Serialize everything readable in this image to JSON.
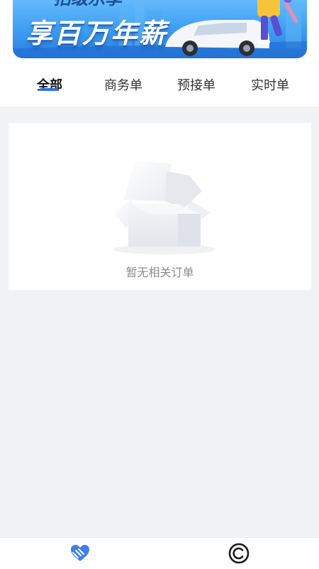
{
  "banner": {
    "partial_top_text": "招级乐享",
    "title": "享百万年薪"
  },
  "tabs": [
    {
      "label": "全部",
      "active": true
    },
    {
      "label": "商务单",
      "active": false
    },
    {
      "label": "预接单",
      "active": false
    },
    {
      "label": "实时单",
      "active": false
    }
  ],
  "empty_state": {
    "icon": "empty-box-icon",
    "message": "暂无相关订单"
  },
  "bottom_nav": [
    {
      "label": "",
      "icon": "heart-hands-icon",
      "active": true
    },
    {
      "label": "",
      "icon": "c-circle-icon",
      "active": false
    }
  ],
  "colors": {
    "accent": "#2f6fe8",
    "background": "#f1f2f4",
    "text": "#333333",
    "muted": "#8c8c8c"
  }
}
